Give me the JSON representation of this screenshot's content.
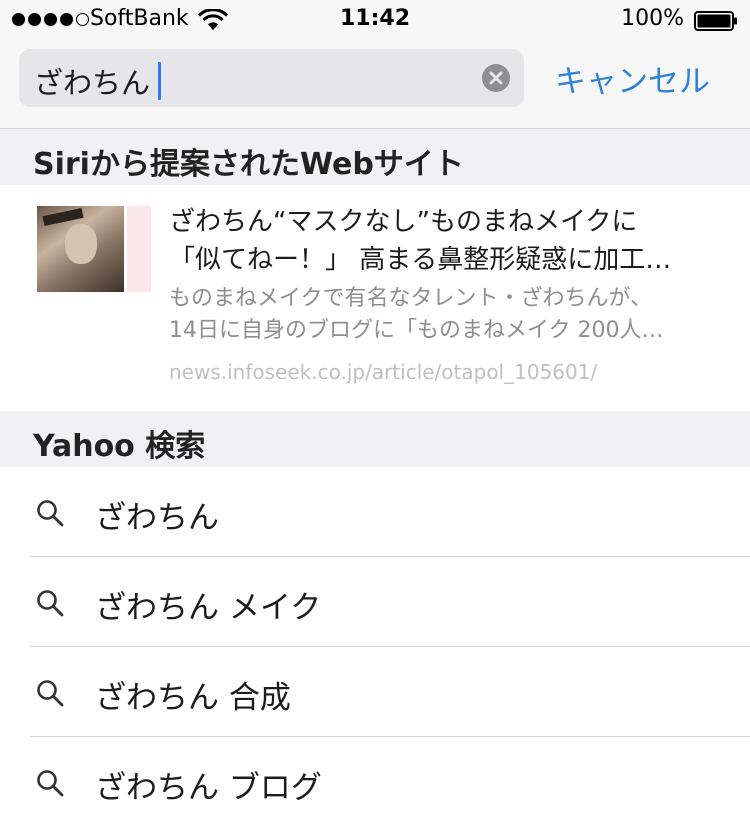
{
  "status_bar": {
    "carrier": "SoftBank",
    "time": "11:42",
    "battery": "100%"
  },
  "search": {
    "query": "ざわちん",
    "cancel_label": "キャンセル"
  },
  "siri_section": {
    "header": "Siriから提案されたWebサイト",
    "result": {
      "title_line1": "ざわちん“マスクなし”ものまねメイクに",
      "title_line2": "「似てねー！」 高まる鼻整形疑惑に加工…",
      "desc_line1": "ものまねメイクで有名なタレント・ざわちんが、",
      "desc_line2": "14日に自身のブログに「ものまねメイク 200人…",
      "url": "news.infoseek.co.jp/article/otapol_105601/"
    }
  },
  "yahoo_section": {
    "header": "Yahoo 検索",
    "suggestions": [
      "ざわちん",
      "ざわちん メイク",
      "ざわちん 合成",
      "ざわちん ブログ"
    ]
  },
  "icons": {
    "search": "magnifier-icon",
    "clear": "clear-circle-icon",
    "wifi": "wifi-icon",
    "battery": "battery-icon"
  },
  "colors": {
    "accent": "#2f82d8",
    "caret": "#3478f6",
    "secondary_text": "#8e8e93"
  }
}
